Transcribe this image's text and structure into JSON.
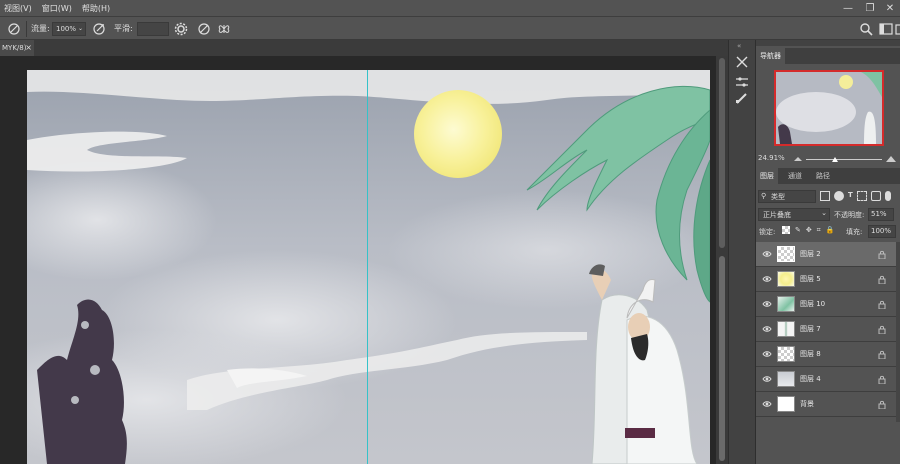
{
  "menu": {
    "items": [
      "视图(V)",
      "窗口(W)",
      "帮助(H)"
    ]
  },
  "window_controls": {
    "minimize": "—",
    "restore": "❐",
    "close": "✕"
  },
  "options": {
    "flow_label": "流量:",
    "flow_value": "100%",
    "smooth_label": "平滑:",
    "smooth_value": ""
  },
  "document": {
    "tab_label": "MYK/8)",
    "tab_close": "×"
  },
  "navigator": {
    "title": "导航器",
    "zoom": "24.91%"
  },
  "layers_panel": {
    "tabs": [
      "图层",
      "通道",
      "路径"
    ],
    "filter_label": "类型",
    "blend_mode": "正片叠底",
    "opacity_label": "不透明度:",
    "opacity_value": "51%",
    "lock_label": "锁定:",
    "fill_label": "填充:",
    "fill_value": "100%",
    "layers": [
      {
        "name": "图层 2",
        "thumb": "checker",
        "selected": true
      },
      {
        "name": "图层 5",
        "thumb": "moon",
        "selected": false
      },
      {
        "name": "图层 10",
        "thumb": "leaf",
        "selected": false
      },
      {
        "name": "图层 7",
        "thumb": "figure",
        "selected": false
      },
      {
        "name": "图层 8",
        "thumb": "checker",
        "selected": false
      },
      {
        "name": "图层 4",
        "thumb": "cloud",
        "selected": false
      },
      {
        "name": "背景",
        "thumb": "white",
        "selected": false
      }
    ]
  },
  "colors": {
    "accent_red": "#d42b2b",
    "guide": "#35c2c9",
    "panel_bg": "#535353"
  }
}
